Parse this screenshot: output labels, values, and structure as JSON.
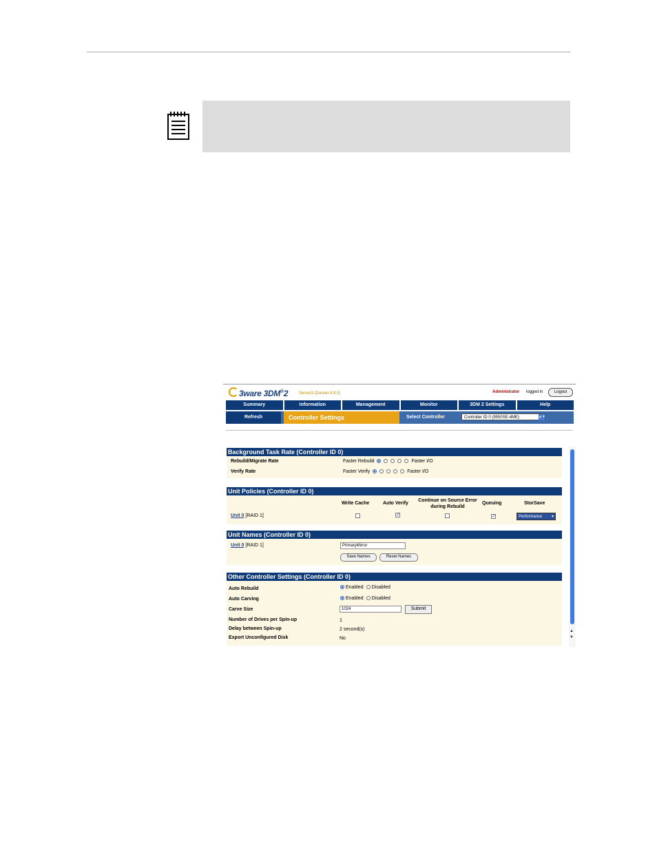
{
  "header": {
    "logo_brand": "3ware",
    "logo_product": "3DM",
    "logo_version": "2",
    "server": "Server3 (Darwin 8.8.0)",
    "admin_label": "Administrator",
    "logged_in_text": "logged in",
    "logout_label": "Logout"
  },
  "menu": {
    "items": [
      "Summary",
      "Information",
      "Management",
      "Monitor",
      "3DM 2 Settings",
      "Help"
    ],
    "refresh_label": "Refresh",
    "current_page": "Controller Settings",
    "select_controller_label": "Select Controller",
    "selected_controller": "Controller ID 0 (9550SE-4ME)"
  },
  "background_task": {
    "title": "Background Task Rate (Controller ID 0)",
    "rows": [
      {
        "label": "Rebuild/Migrate Rate",
        "left": "Faster Rebuild",
        "right": "Faster I/O",
        "selected": 1
      },
      {
        "label": "Verify Rate",
        "left": "Faster Verify",
        "right": "Faster I/O",
        "selected": 1
      }
    ]
  },
  "unit_policies": {
    "title": "Unit Policies (Controller ID 0)",
    "columns": [
      "Write Cache",
      "Auto Verify",
      "Continue on Source Error during Rebuild",
      "Queuing",
      "StorSave"
    ],
    "unit_link": "Unit 0",
    "unit_type": "[RAID 1]",
    "write_cache": false,
    "auto_verify": true,
    "continue_on_error": false,
    "queuing": true,
    "storsave": "Performance"
  },
  "unit_names": {
    "title": "Unit Names (Controller ID 0)",
    "unit_link": "Unit 0",
    "unit_type": "[RAID 1]",
    "name_value": "PrimaryMirror",
    "save_label": "Save Names",
    "reset_label": "Reset Names"
  },
  "other_settings": {
    "title": "Other Controller Settings (Controller ID 0)",
    "auto_rebuild_label": "Auto Rebuild",
    "auto_carving_label": "Auto Carving",
    "enabled_label": "Enabled",
    "disabled_label": "Disabled",
    "carve_size_label": "Carve Size",
    "carve_size_value": "1024",
    "submit_label": "Submit",
    "drives_spinup_label": "Number of Drives per Spin-up",
    "drives_spinup_value": "1",
    "delay_label": "Delay between Spin-up",
    "delay_value": "2 second(s)",
    "export_label": "Export Unconfigured Disk",
    "export_value": "No"
  },
  "colors": {
    "nav_blue": "#0f3a78",
    "accent_orange": "#e8a317",
    "panel_cream": "#fbf7e2",
    "note_gray": "#dcdcdc"
  }
}
